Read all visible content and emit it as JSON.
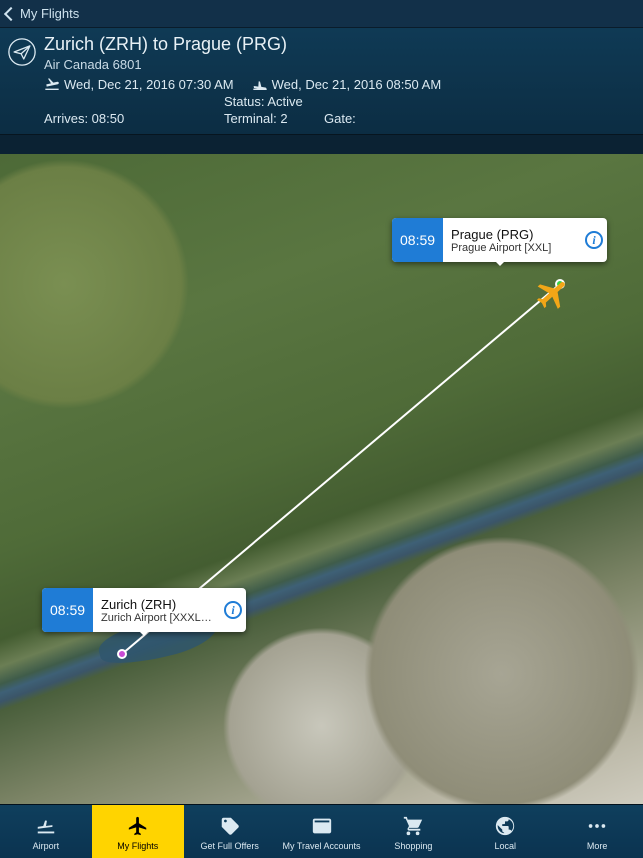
{
  "nav": {
    "back_label": "My Flights"
  },
  "header": {
    "title": "Zurich (ZRH) to Prague (PRG)",
    "airline": "Air Canada 6801",
    "dep_datetime": "Wed, Dec 21, 2016 07:30 AM",
    "arr_datetime": "Wed, Dec 21, 2016 08:50 AM",
    "status_label": "Status: Active",
    "arrives_label": "Arrives: 08:50",
    "terminal_label": "Terminal: 2",
    "gate_label": "Gate:"
  },
  "callouts": {
    "origin": {
      "time": "08:59",
      "title": "Zurich (ZRH)",
      "sub": "Zurich Airport [XXXL] F..."
    },
    "destination": {
      "time": "08:59",
      "title": "Prague (PRG)",
      "sub": "Prague Airport [XXL]"
    }
  },
  "tabs": {
    "airport": "Airport",
    "my_flights": "My Flights",
    "get_offers": "Get Full Offers",
    "travel_accounts": "My Travel Accounts",
    "shopping": "Shopping",
    "local": "Local",
    "more": "More"
  },
  "colors": {
    "accent_blue": "#1f7cd6",
    "active_yellow": "#ffd400"
  }
}
